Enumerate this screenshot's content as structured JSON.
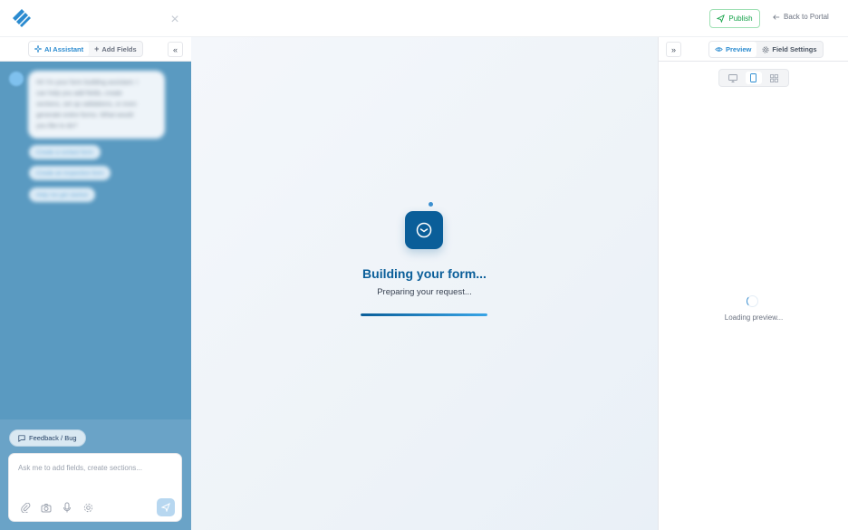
{
  "topbar": {
    "publish_label": "Publish",
    "back_label": "Back to Portal"
  },
  "left": {
    "tabs": [
      {
        "label": "AI Assistant",
        "icon": "sparkle-icon",
        "active": true
      },
      {
        "label": "Add Fields",
        "icon": "plus-icon",
        "active": false
      }
    ],
    "assistant_message_lines": [
      "Hi! I'm your form building assistant. I",
      "can help you add fields, create",
      "sections, set up validations, or even",
      "generate entire forms. What would",
      "you like to do?"
    ],
    "suggestions": [
      "Create a contact form",
      "Create an inspection form",
      "Help me get started"
    ],
    "feedback_label": "Feedback / Bug",
    "input_placeholder": "Ask me to add fields, create sections..."
  },
  "center": {
    "title": "Building your form...",
    "subtitle": "Preparing your request...",
    "progress": 1.0
  },
  "right": {
    "tabs": [
      {
        "label": "Preview",
        "icon": "eye-icon",
        "active": true
      },
      {
        "label": "Field Settings",
        "icon": "gear-icon",
        "active": false
      }
    ],
    "devices": [
      "desktop-icon",
      "mobile-icon",
      "grid-icon"
    ],
    "active_device": "mobile-icon",
    "loading_text": "Loading preview..."
  },
  "colors": {
    "accent": "#0a5e99",
    "link": "#2b8bd0",
    "publish": "#16a34a",
    "left_panel_bg": "#5a9ac1"
  }
}
